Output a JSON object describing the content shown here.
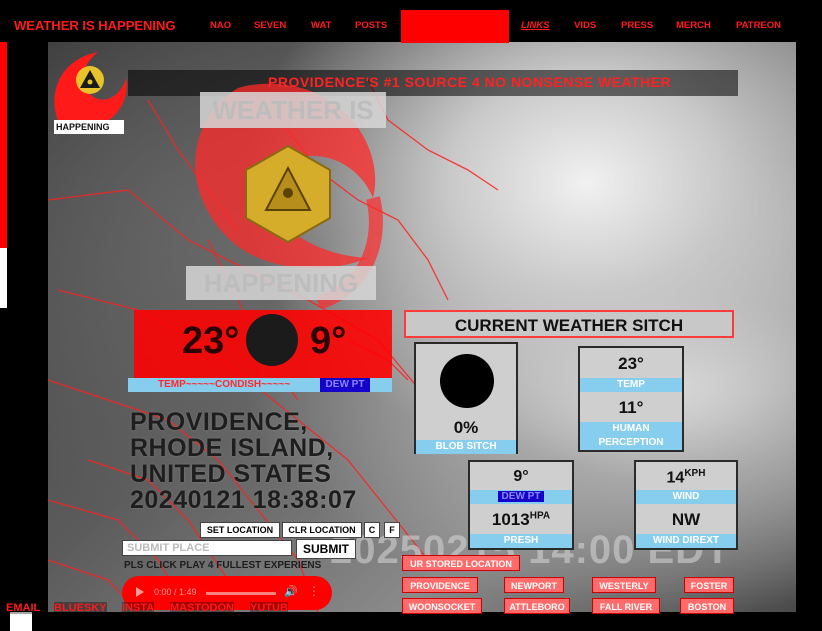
{
  "nav": {
    "brand": "WEATHER IS HAPPENING",
    "items": [
      "NAO",
      "SEVEN",
      "WAT",
      "POSTS",
      "LINKS",
      "VIDS",
      "PRESS",
      "MERCH",
      "PATREON"
    ]
  },
  "banner": {
    "text": "PROVIDENCE'S #1 SOURCE 4 NO NONSENSE WEATHER"
  },
  "logo": {
    "small_label": "HAPPENING",
    "title_top": "WEATHER IS",
    "title_bottom": "HAPPENING"
  },
  "temp_panel": {
    "temp": "23°",
    "dew": "9°",
    "legend": "TEMP~~~~~CONDISH~~~~~",
    "dew_label": "DEW PT"
  },
  "location": {
    "line1": "PROVIDENCE,",
    "line2": "RHODE ISLAND,",
    "line3": "UNITED STATES",
    "datetime": "20240121 18:38:07"
  },
  "controls": {
    "set_location": "SET LOCATION",
    "clr_location": "CLR LOCATION",
    "c": "C",
    "f": "F",
    "submit_placeholder": "SUBMIT PLACE",
    "submit": "SUBMIT",
    "pls": "PLS CLICK PLAY 4 FULLEST EXPERIENS"
  },
  "audio": {
    "time": "0:00 / 1:49"
  },
  "social": [
    "EMAIL",
    "BLUESKY",
    "INSTA",
    "MASTODON",
    "YUTUB"
  ],
  "timestamp_overlay": "20250215 14:00  EDT",
  "current": {
    "header": "CURRENT WEATHER SITCH",
    "blob_value": "0%",
    "blob_label": "BLOB SITCH",
    "temp_value": "23°",
    "temp_label": "TEMP",
    "human_value": "11°",
    "human_label": "HUMAN PERCEPTION",
    "dew_value": "9°",
    "dew_label": "DEW PT",
    "pres_value": "1013",
    "pres_unit": "HPA",
    "pres_label": "PRESH",
    "wind_value": "14",
    "wind_unit": "KPH",
    "wind_label": "WIND",
    "dir_value": "NW",
    "dir_label": "WIND DIREXT"
  },
  "stored": {
    "header": "UR STORED LOCATION",
    "cities": [
      "PROVIDENCE",
      "NEWPORT",
      "WESTERLY",
      "FOSTER",
      "WOONSOCKET",
      "ATTLEBORO",
      "FALL RIVER",
      "BOSTON"
    ]
  },
  "colors": {
    "accent": "#ff1a1a",
    "label_blue": "#87cdee",
    "dew_blue": "#1500cc"
  }
}
